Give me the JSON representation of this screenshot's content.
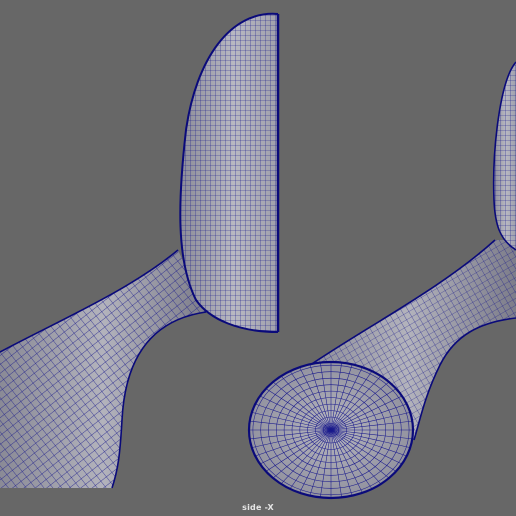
{
  "viewport": {
    "camera_label": "side -X",
    "background_color": "#676767",
    "mesh_fill_color": "#a9a9b3",
    "wire_color": "#0e0e85",
    "display_mode": "wireframe-on-shaded"
  }
}
